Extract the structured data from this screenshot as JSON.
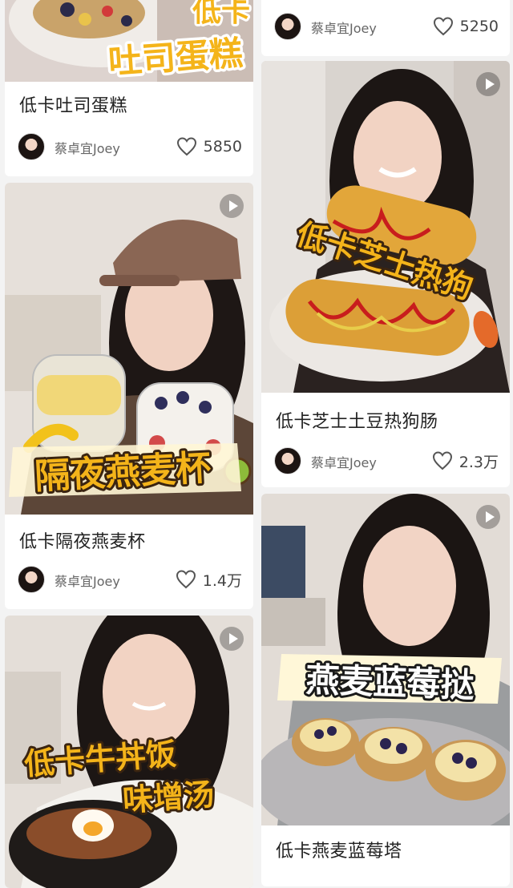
{
  "colors": {
    "background": "#f3f3f3",
    "card": "#ffffff",
    "overlay_fill": "#f4b41a",
    "overlay_stroke": "#3a2410",
    "overlay_light_fill": "#ffffff"
  },
  "icons": {
    "like": "heart-outline-icon",
    "play": "play-icon"
  },
  "cards": {
    "toast_cake": {
      "overlay": [
        "低卡",
        "吐司蛋糕"
      ],
      "title": "低卡吐司蛋糕",
      "author": "蔡卓宜Joey",
      "likes": "5850"
    },
    "top_right": {
      "author": "蔡卓宜Joey",
      "likes": "5250"
    },
    "hotdog": {
      "overlay": "低卡芝士热狗",
      "title": "低卡芝士土豆热狗肠",
      "author": "蔡卓宜Joey",
      "likes": "2.3万"
    },
    "oat_cup": {
      "overlay": "隔夜燕麦杯",
      "title": "低卡隔夜燕麦杯",
      "author": "蔡卓宜Joey",
      "likes": "1.4万"
    },
    "beef_bowl": {
      "overlay": [
        "低卡牛丼饭",
        "味增汤"
      ]
    },
    "blueberry_tart": {
      "overlay": "燕麦蓝莓挞",
      "title": "低卡燕麦蓝莓塔"
    }
  }
}
